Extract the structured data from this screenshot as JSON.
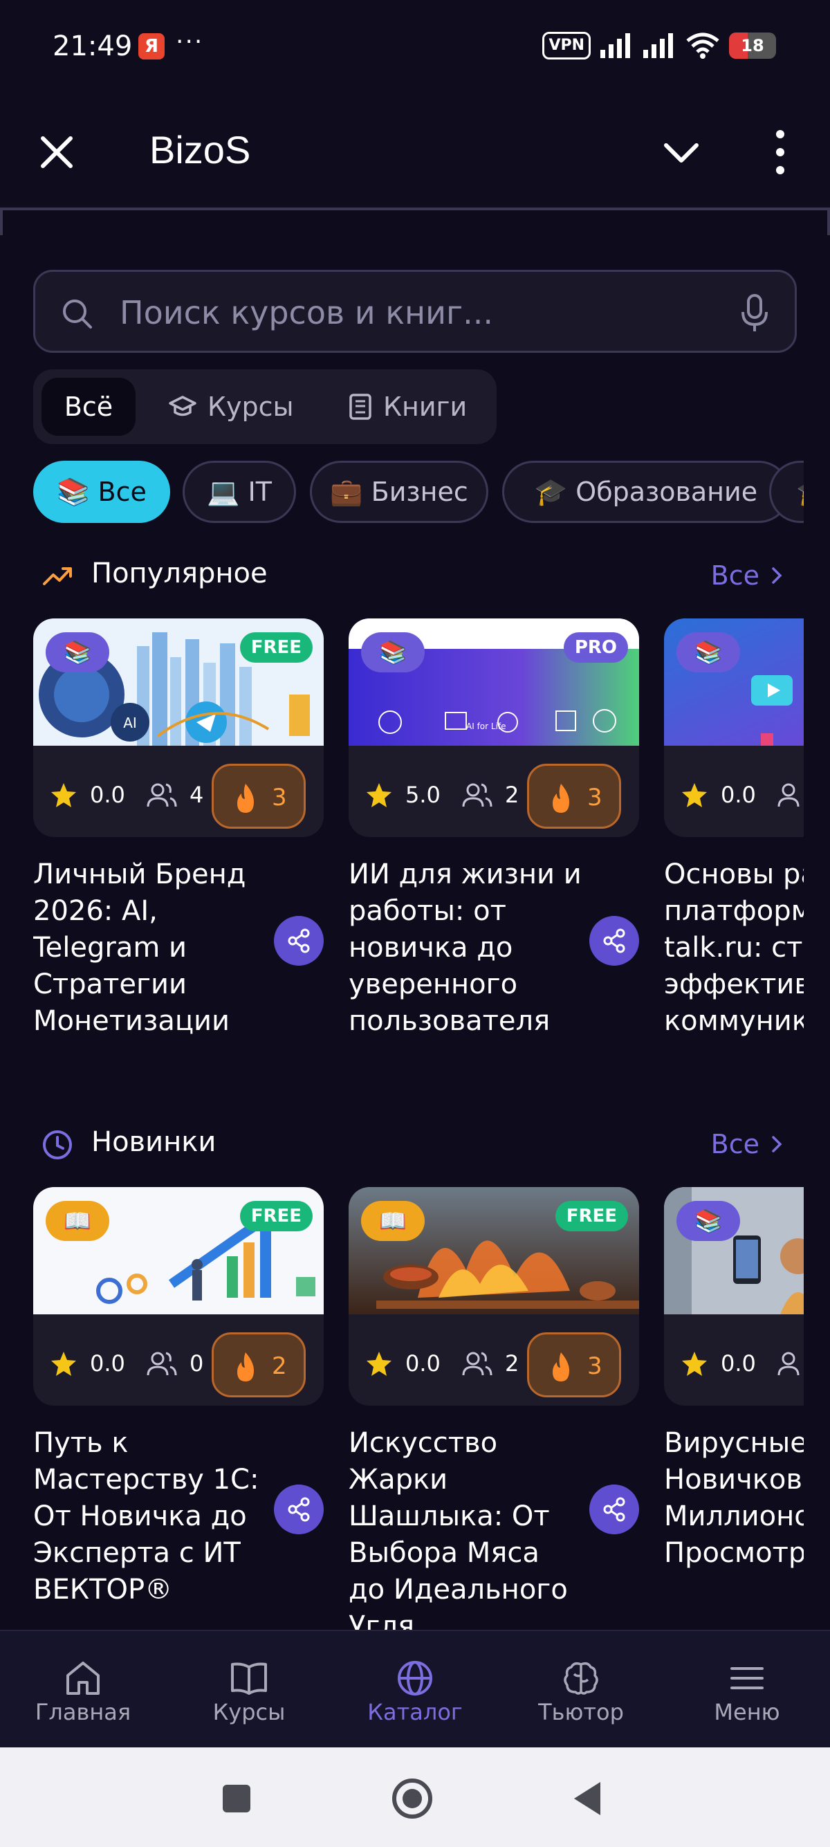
{
  "status_bar": {
    "time": "21:49",
    "ya_label": "Я",
    "dots": "···",
    "vpn": "VPN",
    "battery": "18"
  },
  "header": {
    "title": "BizoS"
  },
  "search": {
    "placeholder": "Поиск курсов и книг..."
  },
  "segments": [
    {
      "label": "Всё",
      "icon": "none"
    },
    {
      "label": "Курсы",
      "icon": "graduation-cap-icon"
    },
    {
      "label": "Книги",
      "icon": "book-icon"
    }
  ],
  "chips": [
    {
      "label": "📚 Все"
    },
    {
      "label": "💻 IT"
    },
    {
      "label": "💼 Бизнес"
    },
    {
      "label": "🎓 Образование"
    },
    {
      "label": "🎓"
    }
  ],
  "popular": {
    "title": "Популярное",
    "all_label": "Все",
    "cards": [
      {
        "type_emoji": "📚",
        "tier": "FREE",
        "rating": "0.0",
        "users": "4",
        "fire": "3",
        "title": "Личный Бренд 2026: AI, Telegram и Стратегии Монетизации"
      },
      {
        "type_emoji": "📚",
        "tier": "PRO",
        "rating": "5.0",
        "users": "2",
        "fire": "3",
        "title": "ИИ для жизни и работы: от новичка до уверенного пользователя"
      },
      {
        "type_emoji": "📚",
        "tier": "",
        "rating": "0.0",
        "users": "",
        "fire": "",
        "title": "Основы работы на платформе pro-talk.ru: старт в эффективной коммуникации"
      }
    ]
  },
  "new": {
    "title": "Новинки",
    "all_label": "Все",
    "cards": [
      {
        "type_emoji": "📖",
        "tier": "FREE",
        "rating": "0.0",
        "users": "0",
        "fire": "2",
        "title": "Путь к Мастерству 1С: От Новичка до Эксперта с ИТ ВЕКТОР®"
      },
      {
        "type_emoji": "📖",
        "tier": "FREE",
        "rating": "0.0",
        "users": "2",
        "fire": "3",
        "title": "Искусство Жарки Шашлыка: От Выбора Мяса до Идеального Угля"
      },
      {
        "type_emoji": "📚",
        "tier": "",
        "rating": "0.0",
        "users": "",
        "fire": "",
        "title": "Вирусные для Новичков: Идеи до Миллионов Просмотров"
      }
    ]
  },
  "nav": [
    {
      "label": "Главная",
      "icon": "home-icon"
    },
    {
      "label": "Курсы",
      "icon": "book-open-icon"
    },
    {
      "label": "Каталог",
      "icon": "globe-icon"
    },
    {
      "label": "Тьютор",
      "icon": "brain-icon"
    },
    {
      "label": "Меню",
      "icon": "menu-icon"
    }
  ],
  "colors": {
    "accent": "#7b6fe0",
    "chip_active": "#2cc8ea",
    "free": "#19b87a",
    "fire": "#ff9e3d"
  }
}
